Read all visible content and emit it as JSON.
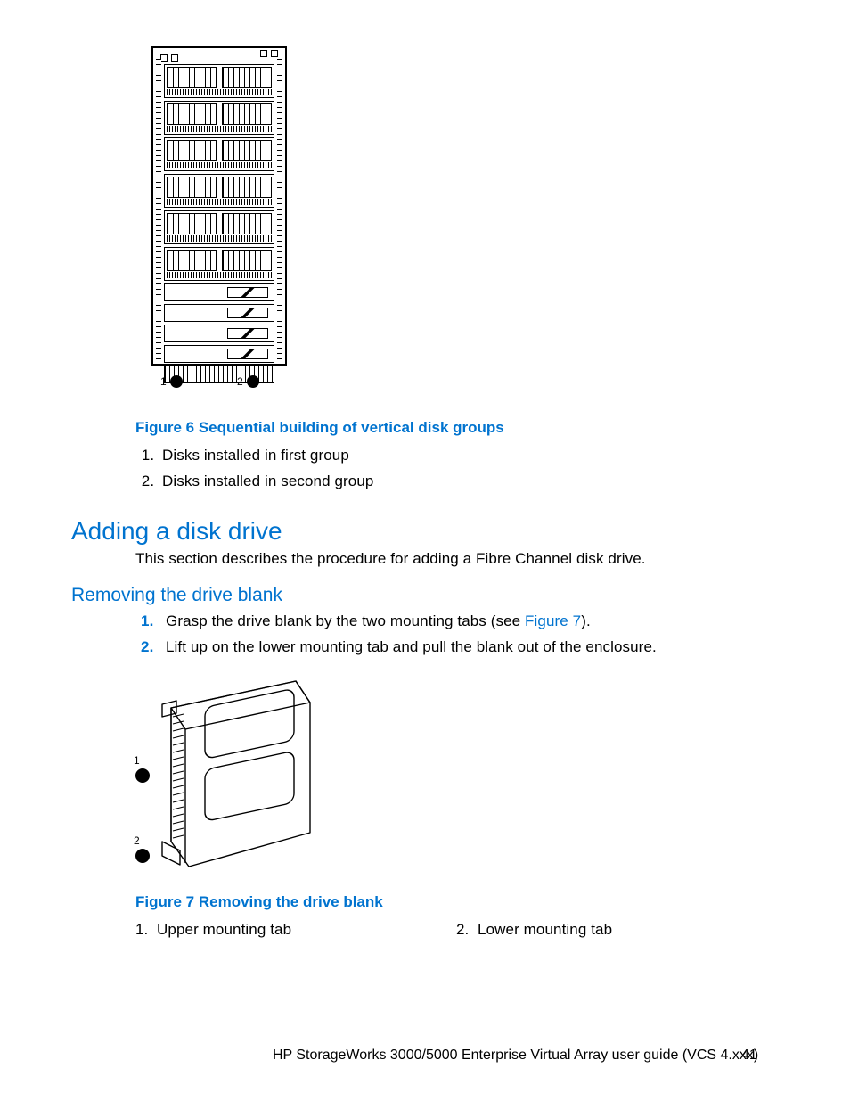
{
  "figure6": {
    "caption": "Figure 6 Sequential building of vertical disk groups",
    "legend": [
      "Disks installed in first group",
      "Disks installed in second group"
    ],
    "callouts": [
      "1",
      "2"
    ]
  },
  "section": {
    "heading": "Adding a disk drive",
    "intro": "This section describes the procedure for adding a Fibre Channel disk drive."
  },
  "subsection": {
    "heading": "Removing the drive blank",
    "steps": [
      {
        "pre": "Grasp the drive blank by the two mounting tabs (see ",
        "link": "Figure 7",
        "post": ")."
      },
      {
        "pre": "Lift up on the lower mounting tab and pull the blank out of the enclosure.",
        "link": "",
        "post": ""
      }
    ]
  },
  "figure7": {
    "caption": "Figure 7 Removing the drive blank",
    "legend": [
      "Upper mounting tab",
      "Lower mounting tab"
    ],
    "callouts": [
      "1",
      "2"
    ]
  },
  "footer": {
    "title": "HP StorageWorks 3000/5000 Enterprise Virtual Array user guide (VCS 4.xxx)",
    "page": "41"
  }
}
